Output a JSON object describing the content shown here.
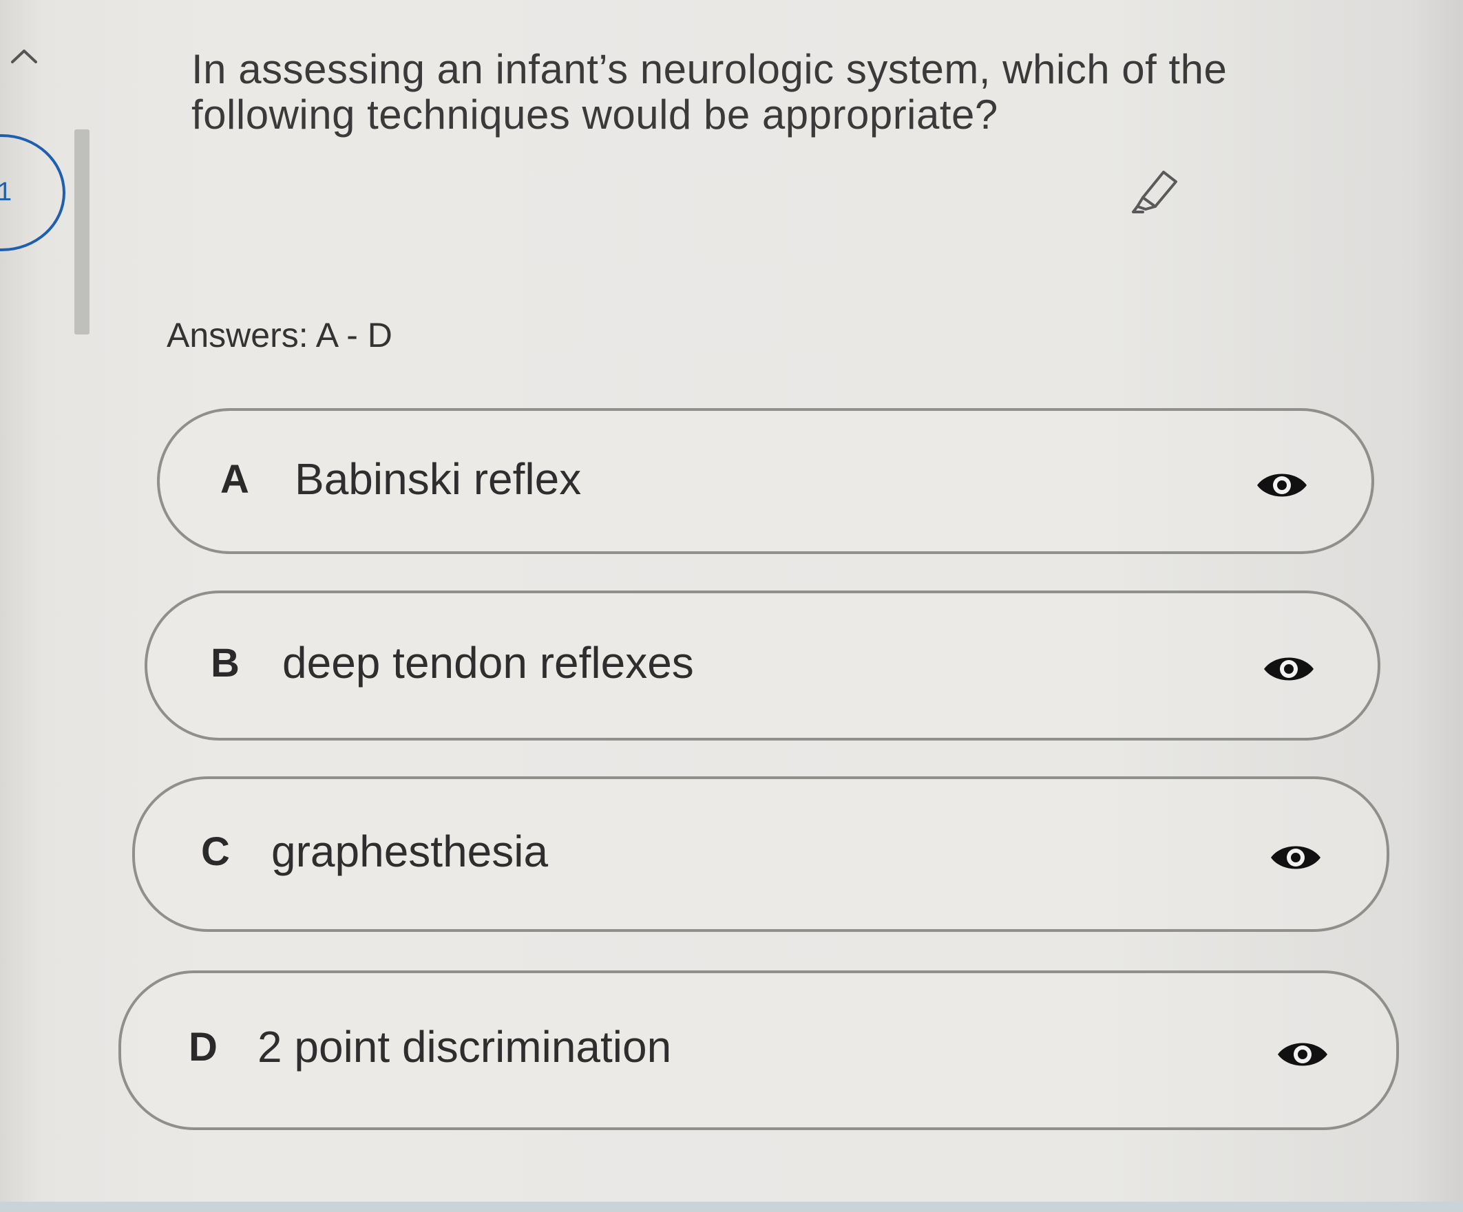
{
  "sidebar": {
    "collapse_icon": "chevron-up-icon",
    "question_number": "1"
  },
  "question": {
    "text": "In assessing an infant’s neurologic system, which of the following techniques would be appropriate?",
    "highlight_icon": "highlighter-icon"
  },
  "answers_label": "Answers: A - D",
  "options": [
    {
      "letter": "A",
      "text": "Babinski reflex",
      "icon": "eye-icon"
    },
    {
      "letter": "B",
      "text": "deep tendon reflexes",
      "icon": "eye-icon"
    },
    {
      "letter": "C",
      "text": "graphesthesia",
      "icon": "eye-icon"
    },
    {
      "letter": "D",
      "text": "2 point discrimination",
      "icon": "eye-icon"
    }
  ],
  "colors": {
    "accent": "#1f5fb0",
    "option_border": "#8f8f8b"
  }
}
